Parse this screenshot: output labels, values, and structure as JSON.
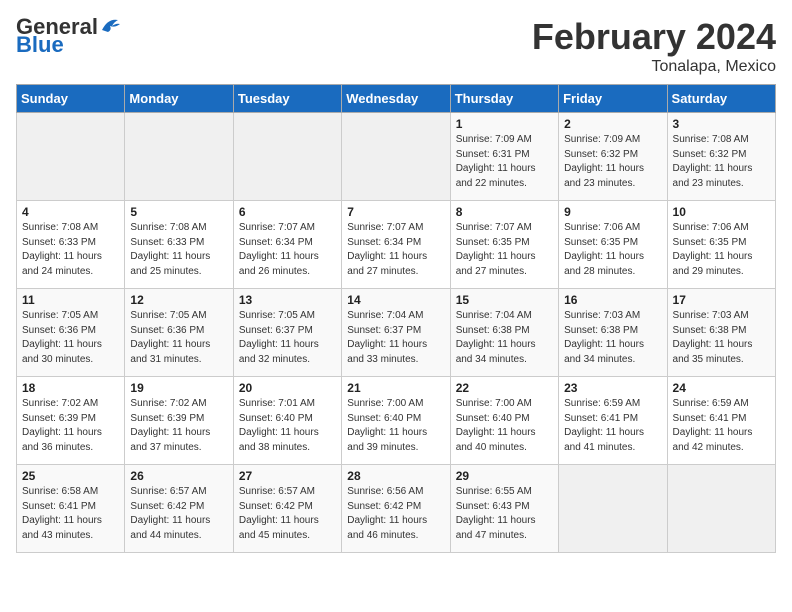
{
  "header": {
    "logo_general": "General",
    "logo_blue": "Blue",
    "title": "February 2024",
    "subtitle": "Tonalapa, Mexico"
  },
  "days_of_week": [
    "Sunday",
    "Monday",
    "Tuesday",
    "Wednesday",
    "Thursday",
    "Friday",
    "Saturday"
  ],
  "weeks": [
    [
      {
        "day": "",
        "info": ""
      },
      {
        "day": "",
        "info": ""
      },
      {
        "day": "",
        "info": ""
      },
      {
        "day": "",
        "info": ""
      },
      {
        "day": "1",
        "info": "Sunrise: 7:09 AM\nSunset: 6:31 PM\nDaylight: 11 hours\nand 22 minutes."
      },
      {
        "day": "2",
        "info": "Sunrise: 7:09 AM\nSunset: 6:32 PM\nDaylight: 11 hours\nand 23 minutes."
      },
      {
        "day": "3",
        "info": "Sunrise: 7:08 AM\nSunset: 6:32 PM\nDaylight: 11 hours\nand 23 minutes."
      }
    ],
    [
      {
        "day": "4",
        "info": "Sunrise: 7:08 AM\nSunset: 6:33 PM\nDaylight: 11 hours\nand 24 minutes."
      },
      {
        "day": "5",
        "info": "Sunrise: 7:08 AM\nSunset: 6:33 PM\nDaylight: 11 hours\nand 25 minutes."
      },
      {
        "day": "6",
        "info": "Sunrise: 7:07 AM\nSunset: 6:34 PM\nDaylight: 11 hours\nand 26 minutes."
      },
      {
        "day": "7",
        "info": "Sunrise: 7:07 AM\nSunset: 6:34 PM\nDaylight: 11 hours\nand 27 minutes."
      },
      {
        "day": "8",
        "info": "Sunrise: 7:07 AM\nSunset: 6:35 PM\nDaylight: 11 hours\nand 27 minutes."
      },
      {
        "day": "9",
        "info": "Sunrise: 7:06 AM\nSunset: 6:35 PM\nDaylight: 11 hours\nand 28 minutes."
      },
      {
        "day": "10",
        "info": "Sunrise: 7:06 AM\nSunset: 6:35 PM\nDaylight: 11 hours\nand 29 minutes."
      }
    ],
    [
      {
        "day": "11",
        "info": "Sunrise: 7:05 AM\nSunset: 6:36 PM\nDaylight: 11 hours\nand 30 minutes."
      },
      {
        "day": "12",
        "info": "Sunrise: 7:05 AM\nSunset: 6:36 PM\nDaylight: 11 hours\nand 31 minutes."
      },
      {
        "day": "13",
        "info": "Sunrise: 7:05 AM\nSunset: 6:37 PM\nDaylight: 11 hours\nand 32 minutes."
      },
      {
        "day": "14",
        "info": "Sunrise: 7:04 AM\nSunset: 6:37 PM\nDaylight: 11 hours\nand 33 minutes."
      },
      {
        "day": "15",
        "info": "Sunrise: 7:04 AM\nSunset: 6:38 PM\nDaylight: 11 hours\nand 34 minutes."
      },
      {
        "day": "16",
        "info": "Sunrise: 7:03 AM\nSunset: 6:38 PM\nDaylight: 11 hours\nand 34 minutes."
      },
      {
        "day": "17",
        "info": "Sunrise: 7:03 AM\nSunset: 6:38 PM\nDaylight: 11 hours\nand 35 minutes."
      }
    ],
    [
      {
        "day": "18",
        "info": "Sunrise: 7:02 AM\nSunset: 6:39 PM\nDaylight: 11 hours\nand 36 minutes."
      },
      {
        "day": "19",
        "info": "Sunrise: 7:02 AM\nSunset: 6:39 PM\nDaylight: 11 hours\nand 37 minutes."
      },
      {
        "day": "20",
        "info": "Sunrise: 7:01 AM\nSunset: 6:40 PM\nDaylight: 11 hours\nand 38 minutes."
      },
      {
        "day": "21",
        "info": "Sunrise: 7:00 AM\nSunset: 6:40 PM\nDaylight: 11 hours\nand 39 minutes."
      },
      {
        "day": "22",
        "info": "Sunrise: 7:00 AM\nSunset: 6:40 PM\nDaylight: 11 hours\nand 40 minutes."
      },
      {
        "day": "23",
        "info": "Sunrise: 6:59 AM\nSunset: 6:41 PM\nDaylight: 11 hours\nand 41 minutes."
      },
      {
        "day": "24",
        "info": "Sunrise: 6:59 AM\nSunset: 6:41 PM\nDaylight: 11 hours\nand 42 minutes."
      }
    ],
    [
      {
        "day": "25",
        "info": "Sunrise: 6:58 AM\nSunset: 6:41 PM\nDaylight: 11 hours\nand 43 minutes."
      },
      {
        "day": "26",
        "info": "Sunrise: 6:57 AM\nSunset: 6:42 PM\nDaylight: 11 hours\nand 44 minutes."
      },
      {
        "day": "27",
        "info": "Sunrise: 6:57 AM\nSunset: 6:42 PM\nDaylight: 11 hours\nand 45 minutes."
      },
      {
        "day": "28",
        "info": "Sunrise: 6:56 AM\nSunset: 6:42 PM\nDaylight: 11 hours\nand 46 minutes."
      },
      {
        "day": "29",
        "info": "Sunrise: 6:55 AM\nSunset: 6:43 PM\nDaylight: 11 hours\nand 47 minutes."
      },
      {
        "day": "",
        "info": ""
      },
      {
        "day": "",
        "info": ""
      }
    ]
  ]
}
